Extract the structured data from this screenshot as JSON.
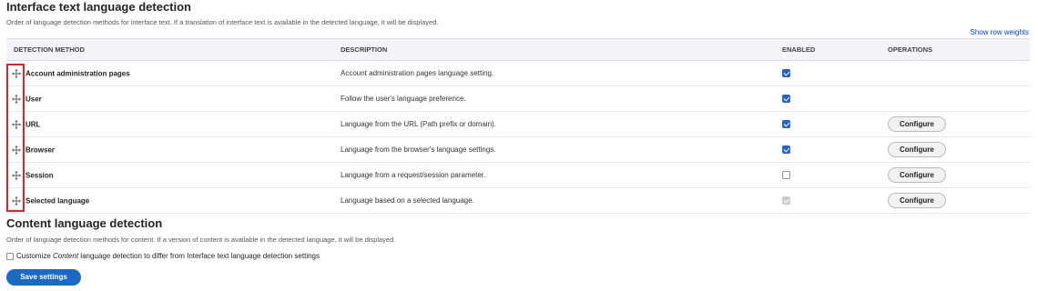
{
  "interface_section": {
    "title": "Interface text language detection",
    "description": "Order of language detection methods for interface text. If a translation of interface text is available in the detected language, it will be displayed.",
    "row_weights_link": "Show row weights",
    "columns": [
      "DETECTION METHOD",
      "DESCRIPTION",
      "ENABLED",
      "OPERATIONS"
    ],
    "rows": [
      {
        "method": "Account administration pages",
        "description": "Account administration pages language setting.",
        "enabled": "checked",
        "operation": ""
      },
      {
        "method": "User",
        "description": "Follow the user's language preference.",
        "enabled": "checked",
        "operation": ""
      },
      {
        "method": "URL",
        "description": "Language from the URL (Path prefix or domain).",
        "enabled": "checked",
        "operation": "Configure"
      },
      {
        "method": "Browser",
        "description": "Language from the browser's language settings.",
        "enabled": "checked",
        "operation": "Configure"
      },
      {
        "method": "Session",
        "description": "Language from a request/session parameter.",
        "enabled": "unchecked",
        "operation": "Configure"
      },
      {
        "method": "Selected language",
        "description": "Language based on a selected language.",
        "enabled": "disabled-checked",
        "operation": "Configure"
      }
    ]
  },
  "content_section": {
    "title": "Content language detection",
    "description": "Order of language detection methods for content. If a version of content is available in the detected language, it will be displayed.",
    "customize_prefix": "Customize",
    "customize_emphasis": "Content",
    "customize_suffix": "language detection to differ from Interface text language detection settings"
  },
  "save_button": "Save settings",
  "colors": {
    "accent": "#1c69c4",
    "link": "#003ecc",
    "highlight": "#d9262e",
    "checkbox_on": "#2860c8"
  },
  "icons": {
    "drag": "drag-handle-icon"
  }
}
